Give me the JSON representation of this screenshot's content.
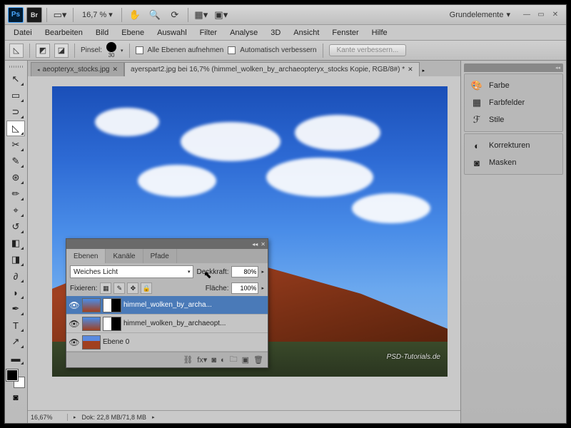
{
  "top": {
    "ps": "Ps",
    "br": "Br",
    "zoom": "16,7 %",
    "workspace": "Grundelemente"
  },
  "menu": [
    "Datei",
    "Bearbeiten",
    "Bild",
    "Ebene",
    "Auswahl",
    "Filter",
    "Analyse",
    "3D",
    "Ansicht",
    "Fenster",
    "Hilfe"
  ],
  "options": {
    "brush_label": "Pinsel:",
    "brush_size": "30",
    "all_layers": "Alle Ebenen aufnehmen",
    "auto_enhance": "Automatisch verbessern",
    "refine_edge": "Kante verbessern..."
  },
  "tabs": {
    "t1": "aeopteryx_stocks.jpg",
    "t2": "ayerspart2.jpg bei 16,7% (himmel_wolken_by_archaeopteryx_stocks Kopie, RGB/8#) *"
  },
  "status": {
    "zoom": "16,67%",
    "doc": "Dok: 22,8 MB/71,8 MB"
  },
  "right_panels": {
    "farbe": "Farbe",
    "farbfelder": "Farbfelder",
    "stile": "Stile",
    "korrekturen": "Korrekturen",
    "masken": "Masken"
  },
  "layers": {
    "tab_ebenen": "Ebenen",
    "tab_kanale": "Kanäle",
    "tab_pfade": "Pfade",
    "blend_mode": "Weiches Licht",
    "opacity_label": "Deckkraft:",
    "opacity": "80%",
    "lock_label": "Fixieren:",
    "fill_label": "Fläche:",
    "fill": "100%",
    "l1": "himmel_wolken_by_archa...",
    "l2": "himmel_wolken_by_archaeopt...",
    "l3": "Ebene 0"
  },
  "watermark": "PSD-Tutorials.de"
}
